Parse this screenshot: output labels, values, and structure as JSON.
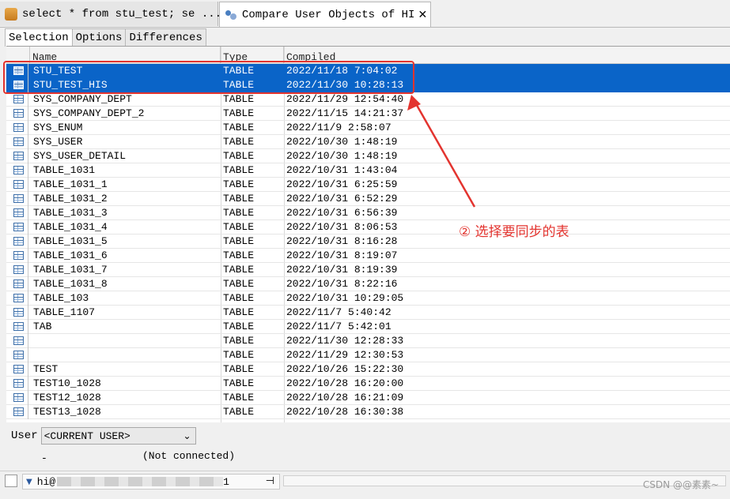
{
  "tabs": {
    "t1": "select * from stu_test; se ...",
    "t2": "Compare User Objects of HI",
    "close": "✕"
  },
  "subtabs": [
    "Selection",
    "Options",
    "Differences"
  ],
  "columns": {
    "name": "Name",
    "type": "Type",
    "compiled": "Compiled"
  },
  "rows": [
    {
      "name": "STU_TEST",
      "type": "TABLE",
      "compiled": "2022/11/18 7:04:02",
      "selected": true
    },
    {
      "name": "STU_TEST_HIS",
      "type": "TABLE",
      "compiled": "2022/11/30 10:28:13",
      "selected": true
    },
    {
      "name": "SYS_COMPANY_DEPT",
      "type": "TABLE",
      "compiled": "2022/11/29 12:54:40"
    },
    {
      "name": "SYS_COMPANY_DEPT_2",
      "type": "TABLE",
      "compiled": "2022/11/15 14:21:37"
    },
    {
      "name": "SYS_ENUM",
      "type": "TABLE",
      "compiled": "2022/11/9 2:58:07"
    },
    {
      "name": "SYS_USER",
      "type": "TABLE",
      "compiled": "2022/10/30 1:48:19"
    },
    {
      "name": "SYS_USER_DETAIL",
      "type": "TABLE",
      "compiled": "2022/10/30 1:48:19"
    },
    {
      "name": "TABLE_1031",
      "type": "TABLE",
      "compiled": "2022/10/31 1:43:04"
    },
    {
      "name": "TABLE_1031_1",
      "type": "TABLE",
      "compiled": "2022/10/31 6:25:59"
    },
    {
      "name": "TABLE_1031_2",
      "type": "TABLE",
      "compiled": "2022/10/31 6:52:29"
    },
    {
      "name": "TABLE_1031_3",
      "type": "TABLE",
      "compiled": "2022/10/31 6:56:39"
    },
    {
      "name": "TABLE_1031_4",
      "type": "TABLE",
      "compiled": "2022/10/31 8:06:53"
    },
    {
      "name": "TABLE_1031_5",
      "type": "TABLE",
      "compiled": "2022/10/31 8:16:28"
    },
    {
      "name": "TABLE_1031_6",
      "type": "TABLE",
      "compiled": "2022/10/31 8:19:07"
    },
    {
      "name": "TABLE_1031_7",
      "type": "TABLE",
      "compiled": "2022/10/31 8:19:39"
    },
    {
      "name": "TABLE_1031_8",
      "type": "TABLE",
      "compiled": "2022/10/31 8:22:16"
    },
    {
      "name": "TABLE_103",
      "type": "TABLE",
      "compiled": "2022/10/31 10:29:05"
    },
    {
      "name": "TABLE_1107",
      "type": "TABLE",
      "compiled": "2022/11/7 5:40:42"
    },
    {
      "name": "TAB",
      "type": "TABLE",
      "compiled": "2022/11/7 5:42:01"
    },
    {
      "name": "",
      "type": "TABLE",
      "compiled": "2022/11/30 12:28:33"
    },
    {
      "name": "",
      "type": "TABLE",
      "compiled": "2022/11/29 12:30:53"
    },
    {
      "name": "TEST",
      "type": "TABLE",
      "compiled": "2022/10/26 15:22:30"
    },
    {
      "name": "TEST10_1028",
      "type": "TABLE",
      "compiled": "2022/10/28 16:20:00"
    },
    {
      "name": "TEST12_1028",
      "type": "TABLE",
      "compiled": "2022/10/28 16:21:09"
    },
    {
      "name": "TEST13_1028",
      "type": "TABLE",
      "compiled": "2022/10/28 16:30:38"
    }
  ],
  "annotation": "② 选择要同步的表",
  "user": {
    "label": "User",
    "value": "<CURRENT USER>"
  },
  "dash": "-",
  "not_connected": "(Not connected)",
  "statusbar": {
    "conn_prefix": "hi@",
    "conn_suffix": "1",
    "watermark": "CSDN @@素素~"
  },
  "colors": {
    "selection": "#0a64c8",
    "annotation": "#e3342f"
  }
}
